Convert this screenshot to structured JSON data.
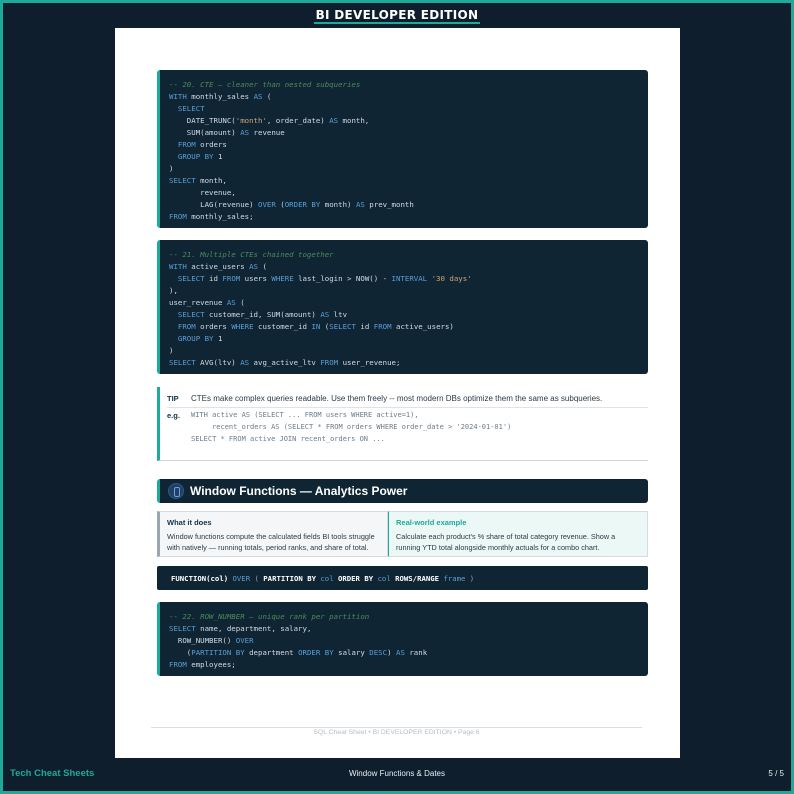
{
  "header": {
    "title": "BI DEVELOPER EDITION"
  },
  "code_blocks": {
    "cte": {
      "lines": [
        [
          {
            "t": "-- 20. CTE — cleaner than nested subqueries",
            "c": "cmt"
          }
        ],
        [
          {
            "t": "WITH",
            "c": "kw"
          },
          {
            "t": " monthly_sales "
          },
          {
            "t": "AS",
            "c": "kw"
          },
          {
            "t": " ("
          }
        ],
        [
          {
            "t": "  "
          },
          {
            "t": "SELECT",
            "c": "kw"
          }
        ],
        [
          {
            "t": "    DATE_TRUNC("
          },
          {
            "t": "'month'",
            "c": "str"
          },
          {
            "t": ", order_date) "
          },
          {
            "t": "AS",
            "c": "kw"
          },
          {
            "t": " month,"
          }
        ],
        [
          {
            "t": "    SUM(amount) "
          },
          {
            "t": "AS",
            "c": "kw"
          },
          {
            "t": " revenue"
          }
        ],
        [
          {
            "t": "  "
          },
          {
            "t": "FROM",
            "c": "kw"
          },
          {
            "t": " orders"
          }
        ],
        [
          {
            "t": "  "
          },
          {
            "t": "GROUP BY",
            "c": "kw"
          },
          {
            "t": " 1"
          }
        ],
        [
          {
            "t": ")"
          }
        ],
        [
          {
            "t": "SELECT",
            "c": "kw"
          },
          {
            "t": " month,"
          }
        ],
        [
          {
            "t": "       revenue,"
          }
        ],
        [
          {
            "t": "       LAG(revenue) "
          },
          {
            "t": "OVER",
            "c": "kw"
          },
          {
            "t": " ("
          },
          {
            "t": "ORDER BY",
            "c": "kw"
          },
          {
            "t": " month) "
          },
          {
            "t": "AS",
            "c": "kw"
          },
          {
            "t": " prev_month"
          }
        ],
        [
          {
            "t": "FROM",
            "c": "kw"
          },
          {
            "t": " monthly_sales;"
          }
        ]
      ]
    },
    "multi_cte": {
      "lines": [
        [
          {
            "t": "-- 21. Multiple CTEs chained together",
            "c": "cmt"
          }
        ],
        [
          {
            "t": "WITH",
            "c": "kw"
          },
          {
            "t": " active_users "
          },
          {
            "t": "AS",
            "c": "kw"
          },
          {
            "t": " ("
          }
        ],
        [
          {
            "t": "  "
          },
          {
            "t": "SELECT",
            "c": "kw"
          },
          {
            "t": " id "
          },
          {
            "t": "FROM",
            "c": "kw"
          },
          {
            "t": " users "
          },
          {
            "t": "WHERE",
            "c": "kw"
          },
          {
            "t": " last_login > NOW() - "
          },
          {
            "t": "INTERVAL",
            "c": "kw"
          },
          {
            "t": " "
          },
          {
            "t": "'30 days'",
            "c": "str"
          }
        ],
        [
          {
            "t": "),"
          }
        ],
        [
          {
            "t": "user_revenue "
          },
          {
            "t": "AS",
            "c": "kw"
          },
          {
            "t": " ("
          }
        ],
        [
          {
            "t": "  "
          },
          {
            "t": "SELECT",
            "c": "kw"
          },
          {
            "t": " customer_id, SUM(amount) "
          },
          {
            "t": "AS",
            "c": "kw"
          },
          {
            "t": " ltv"
          }
        ],
        [
          {
            "t": "  "
          },
          {
            "t": "FROM",
            "c": "kw"
          },
          {
            "t": " orders "
          },
          {
            "t": "WHERE",
            "c": "kw"
          },
          {
            "t": " customer_id "
          },
          {
            "t": "IN",
            "c": "kw"
          },
          {
            "t": " ("
          },
          {
            "t": "SELECT",
            "c": "kw"
          },
          {
            "t": " id "
          },
          {
            "t": "FROM",
            "c": "kw"
          },
          {
            "t": " active_users)"
          }
        ],
        [
          {
            "t": "  "
          },
          {
            "t": "GROUP BY",
            "c": "kw"
          },
          {
            "t": " 1"
          }
        ],
        [
          {
            "t": ")"
          }
        ],
        [
          {
            "t": "SELECT",
            "c": "kw"
          },
          {
            "t": " AVG(ltv) "
          },
          {
            "t": "AS",
            "c": "kw"
          },
          {
            "t": " avg_active_ltv "
          },
          {
            "t": "FROM",
            "c": "kw"
          },
          {
            "t": " user_revenue;"
          }
        ]
      ]
    },
    "row_number": {
      "lines": [
        [
          {
            "t": "-- 22. ROW_NUMBER — unique rank per partition",
            "c": "cmt"
          }
        ],
        [
          {
            "t": "SELECT",
            "c": "kw"
          },
          {
            "t": " name, department, salary,"
          }
        ],
        [
          {
            "t": "  ROW_NUMBER() "
          },
          {
            "t": "OVER",
            "c": "kw"
          }
        ],
        [
          {
            "t": "    ("
          },
          {
            "t": "PARTITION BY",
            "c": "kw"
          },
          {
            "t": " department "
          },
          {
            "t": "ORDER BY",
            "c": "kw"
          },
          {
            "t": " salary "
          },
          {
            "t": "DESC",
            "c": "kw"
          },
          {
            "t": ") "
          },
          {
            "t": "AS",
            "c": "kw"
          },
          {
            "t": " rank"
          }
        ],
        [
          {
            "t": "FROM",
            "c": "kw"
          },
          {
            "t": " employees;"
          }
        ]
      ]
    }
  },
  "tip": {
    "tag": "TIP",
    "text": "CTEs make complex queries readable. Use them freely -- most modern DBs optimize them the same as subqueries.",
    "eg_tag": "e.g.",
    "eg_code": "WITH active AS (SELECT ... FROM users WHERE active=1),\n     recent_orders AS (SELECT * FROM orders WHERE order_date > '2024-01-01')\nSELECT * FROM active JOIN recent_orders ON ..."
  },
  "section": {
    "title": "Window Functions — Analytics Power",
    "icon": "window-function-icon"
  },
  "cards": {
    "what": {
      "heading": "What it does",
      "body": "Window functions compute the calculated fields BI tools struggle with natively — running totals, period ranks, and share of total."
    },
    "example": {
      "heading": "Real-world example",
      "body": "Calculate each product's % share of total category revenue. Show a running YTD total alongside monthly actuals for a combo chart."
    }
  },
  "syntax": {
    "parts": [
      {
        "t": "FUNCTION(col) ",
        "c": "b"
      },
      {
        "t": "OVER ",
        "c": "k"
      },
      {
        "t": "( ",
        "c": "d"
      },
      {
        "t": "PARTITION BY ",
        "c": "b"
      },
      {
        "t": "col ",
        "c": "k"
      },
      {
        "t": "ORDER BY ",
        "c": "b"
      },
      {
        "t": "col ",
        "c": "k"
      },
      {
        "t": "ROWS/RANGE ",
        "c": "b"
      },
      {
        "t": "frame ",
        "c": "k"
      },
      {
        "t": ")",
        "c": "d"
      }
    ]
  },
  "page_footer": "SQL Cheat Sheet  •  BI DEVELOPER EDITION  •  Page 6",
  "bottom_bar": {
    "brand": "Tech Cheat Sheets",
    "center": "Window Functions & Dates",
    "pager": "5 / 5"
  },
  "colors": {
    "accent": "#1fa99a",
    "dark": "#102534",
    "keyword": "#5a9ed6",
    "comment": "#4c8a5a",
    "string": "#c8a675"
  }
}
